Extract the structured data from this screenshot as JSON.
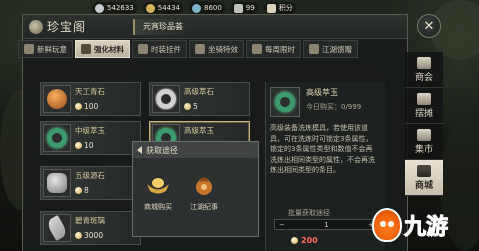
{
  "currencies": [
    {
      "value": "542633",
      "icon": "silver-coin-icon",
      "color": "#c8ccd0"
    },
    {
      "value": "54434",
      "icon": "gold-ingot-icon",
      "color": "#d6b25a"
    },
    {
      "value": "8600",
      "icon": "jade-coin-icon",
      "color": "#7fb4c8"
    },
    {
      "value": "99",
      "icon": "lock-icon",
      "color": "#c0c0c0"
    },
    {
      "value": "积分",
      "icon": "points-icon",
      "color": "#d9d2bf"
    }
  ],
  "header": {
    "title": "珍宝阁",
    "subtitle": "元宵珍品荟"
  },
  "tabs": [
    {
      "label": "新鲜玩意",
      "active": false
    },
    {
      "label": "强化材料",
      "active": true
    },
    {
      "label": "时装挂件",
      "active": false
    },
    {
      "label": "坐骑特效",
      "active": false
    },
    {
      "label": "每周限时",
      "active": false
    },
    {
      "label": "江湖馈赠",
      "active": false
    }
  ],
  "items": [
    {
      "name": "天工青石",
      "price": "100"
    },
    {
      "name": "高级萃石",
      "price": "5"
    },
    {
      "name": "中级萃玉",
      "price": "10"
    },
    {
      "name": "高级萃玉",
      "price": "3"
    },
    {
      "name": "五级源石",
      "price": "8"
    },
    {
      "name": "碧青斑璃",
      "price": "3000"
    }
  ],
  "detail": {
    "name": "高级萃玉",
    "limit": "今日购买：0/999",
    "description": "高级装备洗炼模具，若使用该道具，可在洗炼时可锁定3条属性，锁定的3条属性类型和数值不会再洗炼出相同类型的属性，不会再洗炼出相同类型的条目。",
    "qty_label": "批量获取途径",
    "qty": "1",
    "total": "200"
  },
  "popup": {
    "title": "获取途径",
    "sources": [
      {
        "label": "商城购买",
        "icon": "gold-ingot-icon"
      },
      {
        "label": "江湖纪事",
        "icon": "pouch-icon"
      }
    ]
  },
  "nav": [
    {
      "label": "商会",
      "active": false
    },
    {
      "label": "摆摊",
      "active": false
    },
    {
      "label": "集市",
      "active": false
    },
    {
      "label": "商城",
      "active": true
    }
  ],
  "watermark": "九游",
  "colors": {
    "accent_gold": "#c8b478",
    "price_red": "#ff6a5a",
    "jade_green": "#3c9a6c",
    "watermark_orange": "#ff7b12"
  }
}
